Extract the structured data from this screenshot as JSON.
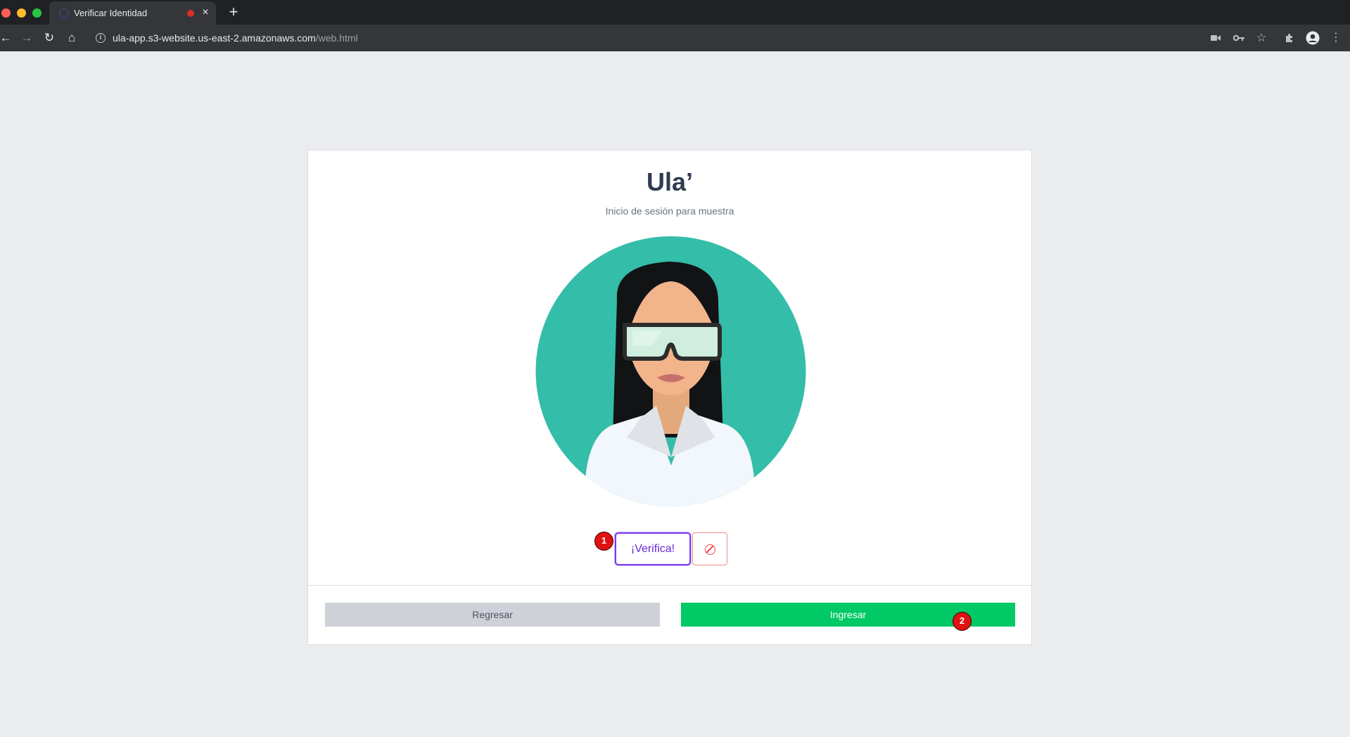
{
  "browser": {
    "tab": {
      "title": "Verificar Identidad",
      "close_glyph": "×"
    },
    "new_tab_glyph": "+",
    "url": {
      "host": "ula-app.s3-website.us-east-2.amazonaws.com",
      "path": "/web.html"
    },
    "nav_glyphs": {
      "back": "←",
      "forward": "→",
      "reload": "↻",
      "home": "⌂"
    },
    "toolbar_icons": [
      "camera-icon",
      "key-icon",
      "star-icon",
      "extensions-icon",
      "profile-icon",
      "menu-icon"
    ]
  },
  "page": {
    "title": "Ula’",
    "subtitle": "Inicio de sesión para muestra",
    "verify_label": "¡Verifica!",
    "back_label": "Regresar",
    "enter_label": "Ingresar"
  },
  "markers": [
    "1",
    "2"
  ],
  "colors": {
    "accent_purple": "#7c3aed",
    "danger": "#ef4444",
    "success": "#00c965",
    "avatar_bg": "#34bda8"
  }
}
